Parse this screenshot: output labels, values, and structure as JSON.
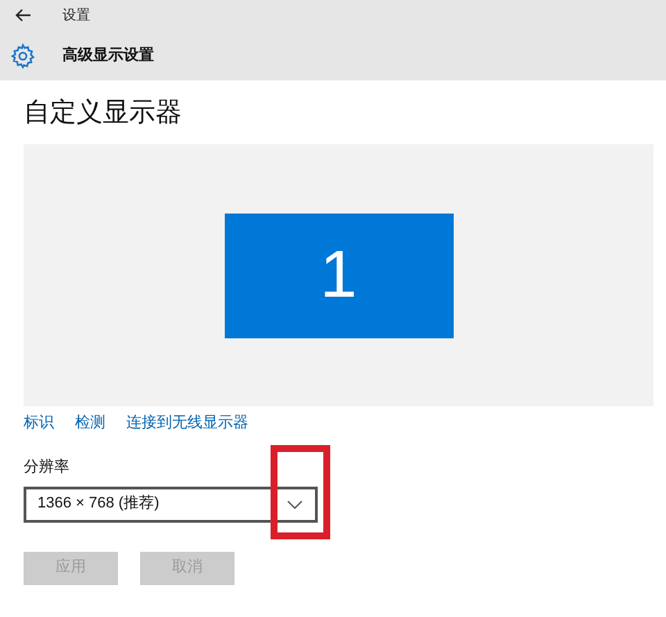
{
  "window": {
    "title": "设置"
  },
  "page": {
    "title": "高级显示设置"
  },
  "section": {
    "title": "自定义显示器"
  },
  "displays": [
    {
      "label": "1",
      "selected": true
    }
  ],
  "links": [
    "标识",
    "检测",
    "连接到无线显示器"
  ],
  "resolution": {
    "label": "分辨率",
    "value": "1366 × 768 (推荐)",
    "highlighted": true
  },
  "buttons": [
    {
      "label": "应用",
      "disabled": true
    },
    {
      "label": "取消",
      "disabled": true
    }
  ]
}
